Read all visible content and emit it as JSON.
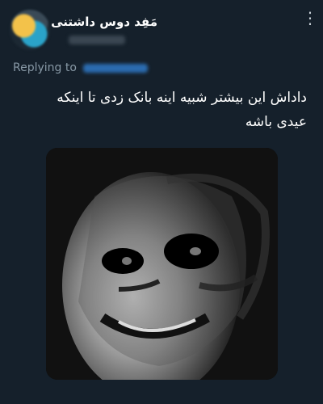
{
  "tweet": {
    "display_name": "مَفِد دوس داشتنی",
    "more_icon": "more-vertical-icon",
    "replying_prefix": "Replying to",
    "text": "داداش این بیشتر شبیه اینه بانک زدی تا اینکه\nعیدی باشه",
    "media": {
      "icon": "meme-image-uncanny-trollface"
    }
  }
}
